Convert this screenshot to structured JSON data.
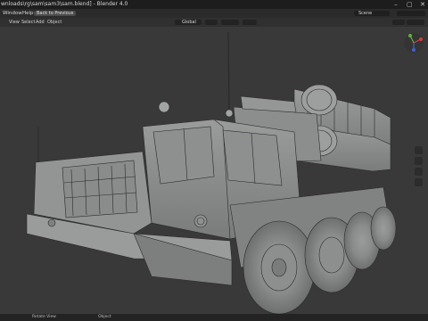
{
  "window": {
    "title": "wnloads\\rg\\sam\\sam3\\sam.blend] - Blender 4.0",
    "controls": [
      "–",
      "▢",
      "✕"
    ]
  },
  "menu": {
    "items": [
      "Window",
      "Help"
    ],
    "back_button": "Back to Previous",
    "scene_field": "Scene"
  },
  "view_header": {
    "items": [
      "View",
      "Select",
      "Add",
      "Object"
    ],
    "orientation": "Global"
  },
  "statusbar": {
    "left": "Rotate View",
    "right": "Object"
  },
  "colors": {
    "background": "#3a3a3a",
    "model": "#8f9190",
    "wire": "#2a2a2a"
  }
}
